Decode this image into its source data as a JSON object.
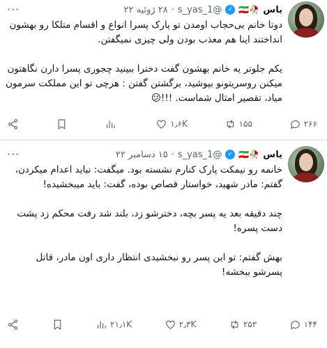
{
  "tweets": [
    {
      "name": "یاس",
      "flag": "🥀🇮🇷",
      "handle": "@s_yas_1",
      "dot": "·",
      "date": "۲۸ ژوئیه ۲۲",
      "text": "دوتا خانم بی‌حجاب اومدن تو پارک پسرا انواع و اقسام متلکا رو بهشون انداختند اینا هم معذب بودن ولی چیزی نمیگفتن.\n\nیکم جلوتر یه خانم بهشون گفت دخترا ببینید چجوری پسرا دارن نگاهتون میکنن روسریتونو بپوشید، برگشتن گفتن : هرچی تو این مملکت سرمون میاد، تقصیر امثال شماست. !!!😕",
      "replies": "۲۶۶",
      "retweets": "۱۵۵",
      "likes": "۱٫۶K",
      "views": ""
    },
    {
      "name": "یاس",
      "flag": "🥀🇮🇷",
      "handle": "@s_yas_1",
      "dot": "·",
      "date": "۱۵ دسامبر ۲۲",
      "text": "خانمه رو نیمکت پارک کنارم نشسته بود. میگفت: نباید اعدام میکردن، گفتم: مادر شهید، خواستار قصاص بوده، گفت: باید میبخشیده!\n\nچند دقیقه بعد یه پسر بچه، دخترشو زد، بلند شد رفت محکم زد پشت دست پسره!\n\nبهش گفتم: تو این پسر رو نبخشیدی انتظار داری اون مادر، قاتل پسرشو ببخشه!",
      "replies": "۱۴۴",
      "retweets": "۲۵۳",
      "likes": "۲٫۳K",
      "views": "۲۱٫۱K"
    }
  ],
  "icons": {
    "reply": "reply-icon",
    "retweet": "retweet-icon",
    "like": "heart-icon",
    "views": "views-icon",
    "bookmark": "bookmark-icon",
    "share": "share-icon",
    "more": "more-icon",
    "verified": "verified-badge-icon"
  }
}
